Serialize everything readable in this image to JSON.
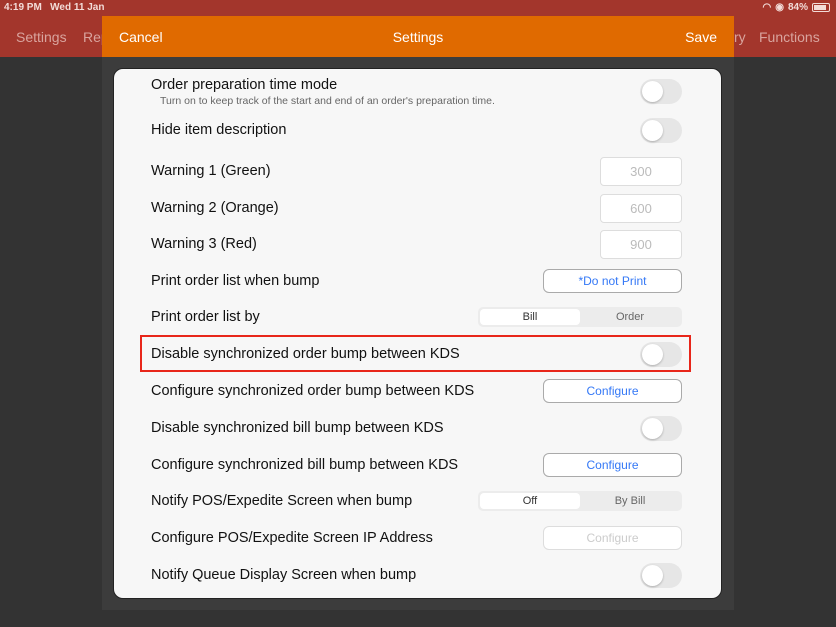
{
  "status": {
    "time": "4:19 PM",
    "date": "Wed 11 Jan",
    "battery": "84%"
  },
  "nav": {
    "left": [
      "Settings",
      "Rep"
    ],
    "right": [
      "ry",
      "Functions"
    ]
  },
  "modal": {
    "cancel": "Cancel",
    "title": "Settings",
    "save": "Save"
  },
  "rows": [
    {
      "label": "Order preparation time mode",
      "sub": "Turn on to keep track of the start and end of an order's preparation time.",
      "toggle": false
    },
    {
      "label": "Hide item description",
      "toggle": false
    },
    {
      "label": "Warning 1 (Green)",
      "value": "300"
    },
    {
      "label": "Warning 2 (Orange)",
      "value": "600"
    },
    {
      "label": "Warning 3 (Red)",
      "value": "900"
    },
    {
      "label": "Print order list when bump",
      "button": "*Do not Print"
    },
    {
      "label": "Print order list by",
      "options": [
        "Bill",
        "Order"
      ],
      "selected": "Bill"
    },
    {
      "label": "Disable synchronized order bump between KDS",
      "toggle": false,
      "highlighted": true
    },
    {
      "label": "Configure synchronized order bump between KDS",
      "button": "Configure"
    },
    {
      "label": "Disable synchronized bill bump between KDS",
      "toggle": false
    },
    {
      "label": "Configure synchronized bill bump between KDS",
      "button": "Configure"
    },
    {
      "label": "Notify POS/Expedite Screen when bump",
      "options": [
        "Off",
        "By Bill"
      ],
      "selected": "Off"
    },
    {
      "label": "Configure POS/Expedite Screen IP Address",
      "button": "Configure",
      "disabled": true
    },
    {
      "label": "Notify Queue Display Screen when bump",
      "toggle": false
    }
  ],
  "colors": {
    "header": "#e06a00",
    "appbar": "#a3362c",
    "highlight": "#e8261a",
    "link": "#3478f6"
  }
}
